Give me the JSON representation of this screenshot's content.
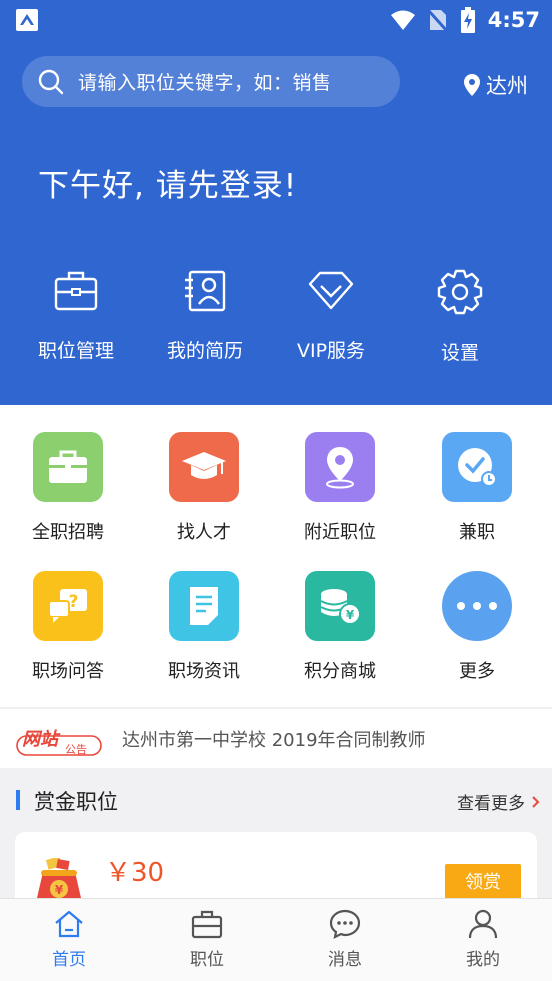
{
  "status_bar": {
    "time": "4:57"
  },
  "search": {
    "placeholder": "请输入职位关键字，如：销售"
  },
  "location": {
    "city": "达州"
  },
  "greeting": "下午好, 请先登录!",
  "quick_actions": [
    {
      "label": "职位管理",
      "icon": "briefcase-icon"
    },
    {
      "label": "我的简历",
      "icon": "resume-icon"
    },
    {
      "label": "VIP服务",
      "icon": "diamond-icon"
    },
    {
      "label": "设置",
      "icon": "settings-gear-icon"
    }
  ],
  "categories": [
    {
      "label": "全职招聘",
      "icon": "briefcase-icon",
      "color": "#8ccf6e"
    },
    {
      "label": "找人才",
      "icon": "graduation-cap-icon",
      "color": "#ef6a4a"
    },
    {
      "label": "附近职位",
      "icon": "location-pin-icon",
      "color": "#9b7ff0"
    },
    {
      "label": "兼职",
      "icon": "clock-check-icon",
      "color": "#5aa7f4"
    },
    {
      "label": "职场问答",
      "icon": "question-chat-icon",
      "color": "#f9c11a"
    },
    {
      "label": "职场资讯",
      "icon": "document-icon",
      "color": "#3fc4e6"
    },
    {
      "label": "积分商城",
      "icon": "coins-icon",
      "color": "#2bb8a0"
    },
    {
      "label": "更多",
      "icon": "more-dots-icon",
      "color": "#5aa2ef"
    }
  ],
  "notice": {
    "badge_main": "网站",
    "badge_sub": "公告",
    "text": "达州市第一中学校 2019年合同制教师"
  },
  "reward_section": {
    "title": "赏金职位",
    "more": "查看更多"
  },
  "reward_card": {
    "price": "￥30",
    "claim": "领赏"
  },
  "tabbar": [
    {
      "label": "首页",
      "icon": "home-icon"
    },
    {
      "label": "职位",
      "icon": "briefcase-icon"
    },
    {
      "label": "消息",
      "icon": "message-icon"
    },
    {
      "label": "我的",
      "icon": "profile-icon"
    }
  ],
  "colors": {
    "primary": "#2f66d0",
    "accent": "#2f7bf0",
    "price": "#f0552a",
    "button": "#f8a913"
  }
}
